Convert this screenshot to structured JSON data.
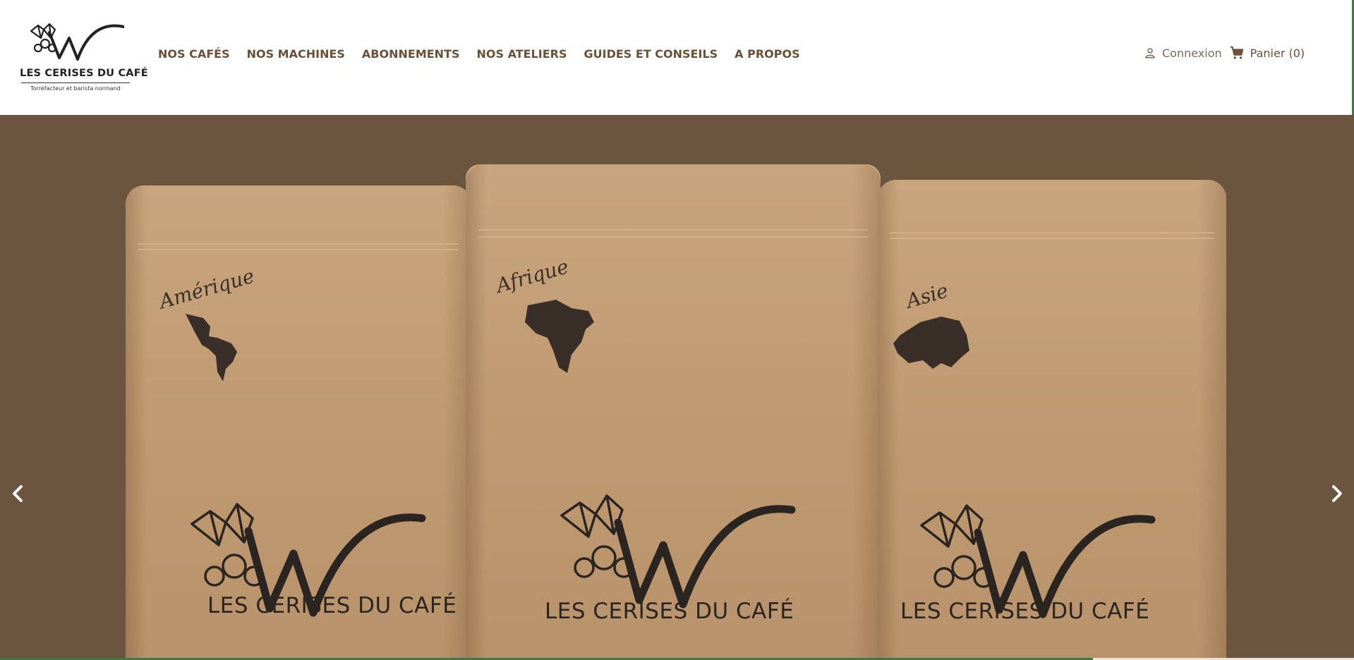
{
  "brand": {
    "name": "LES CERISES DU CAFÉ",
    "tagline": "Torréfacteur et barista normand"
  },
  "nav": {
    "items": [
      {
        "label": "NOS CAFÉS"
      },
      {
        "label": "NOS MACHINES"
      },
      {
        "label": "ABONNEMENTS"
      },
      {
        "label": "NOS ATELIERS"
      },
      {
        "label": "GUIDES ET CONSEILS"
      },
      {
        "label": "A PROPOS"
      }
    ]
  },
  "user": {
    "login_label": "Connexion",
    "cart_label": "Panier (0)"
  },
  "hero": {
    "bags": [
      {
        "region": "Amérique",
        "brand": "LES CERISES DU CAFÉ"
      },
      {
        "region": "Afrique",
        "brand": "LES CERISES DU CAFÉ"
      },
      {
        "region": "Asie",
        "brand": "LES CERISES DU CAFÉ"
      }
    ]
  },
  "colors": {
    "nav_text": "#6a5038",
    "hero_bg": "#6b553e",
    "kraft": "#c09b72",
    "accent_green": "#3d7a48"
  },
  "icons": {
    "user": "user-icon",
    "cart": "cart-icon",
    "prev": "chevron-left-icon",
    "next": "chevron-right-icon"
  }
}
